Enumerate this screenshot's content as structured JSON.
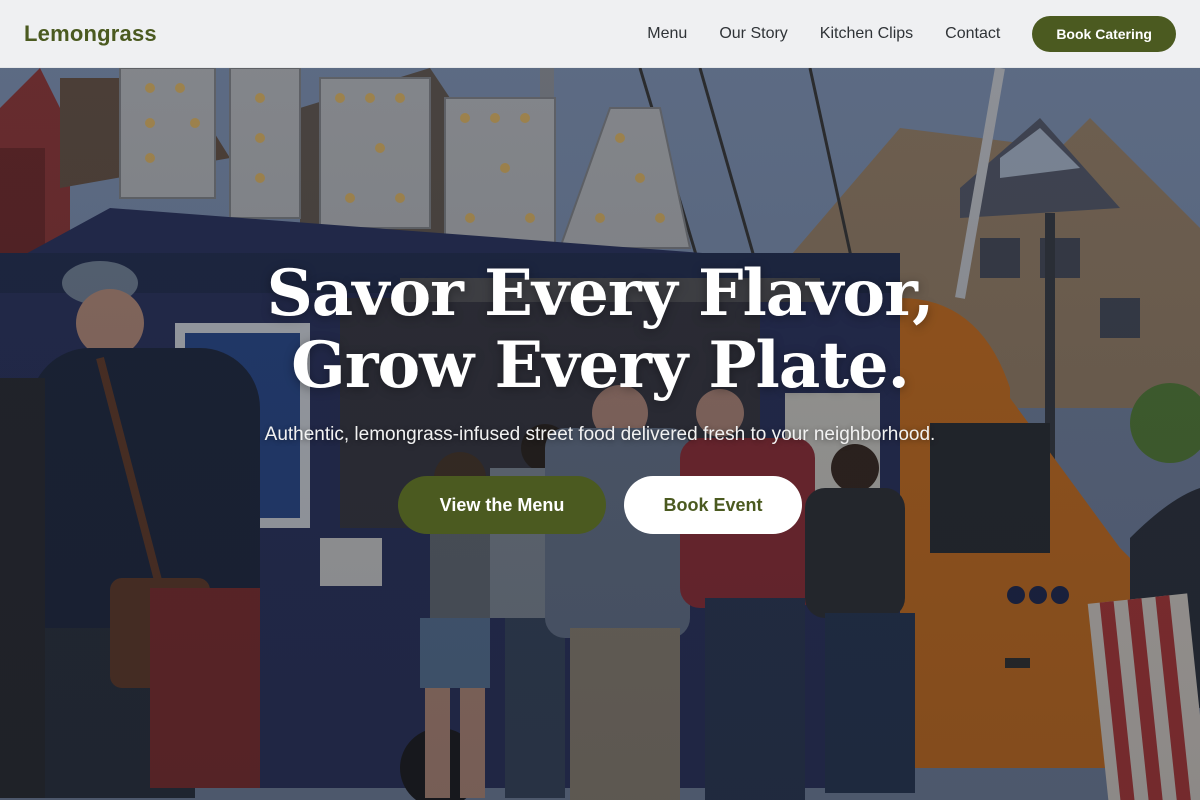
{
  "header": {
    "brand": "Lemongrass",
    "nav": [
      {
        "label": "Menu"
      },
      {
        "label": "Our Story"
      },
      {
        "label": "Kitchen Clips"
      },
      {
        "label": "Contact"
      }
    ],
    "cta_label": "Book Catering"
  },
  "hero": {
    "title_line1": "Savor Every Flavor,",
    "title_line2": "Grow Every Plate.",
    "subtitle": "Authentic, lemongrass-infused street food delivered fresh to your neighborhood.",
    "primary_button": "View the Menu",
    "secondary_button": "Book Event"
  },
  "colors": {
    "brand_green": "#4b5a20",
    "truck_blue": "#2b3566",
    "truck_orange": "#e07a1f",
    "white": "#ffffff"
  }
}
